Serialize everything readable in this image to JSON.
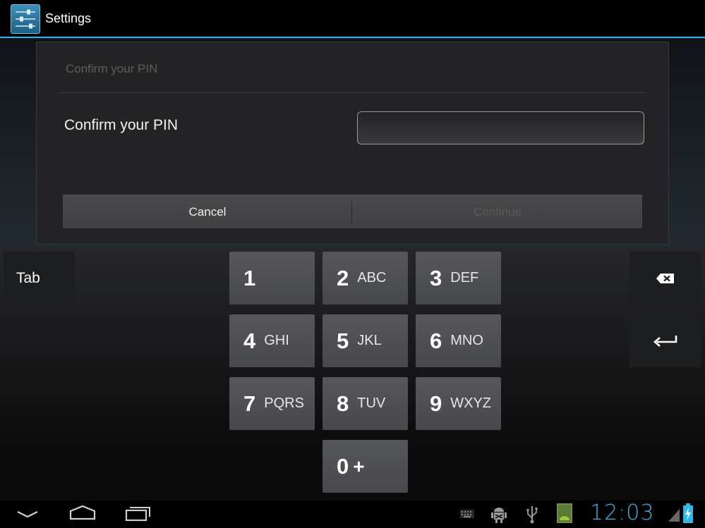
{
  "action_bar": {
    "title": "Settings",
    "icon": "settings-icon"
  },
  "dialog": {
    "title": "Confirm your PIN",
    "field_label": "Confirm your PIN",
    "pin_value": "",
    "buttons": {
      "cancel_label": "Cancel",
      "continue_label": "Continue"
    }
  },
  "keyboard": {
    "tab_label": "Tab",
    "keys": [
      {
        "digit": "1",
        "letters": ""
      },
      {
        "digit": "2",
        "letters": "ABC"
      },
      {
        "digit": "3",
        "letters": "DEF"
      },
      {
        "digit": "4",
        "letters": "GHI"
      },
      {
        "digit": "5",
        "letters": "JKL"
      },
      {
        "digit": "6",
        "letters": "MNO"
      },
      {
        "digit": "7",
        "letters": "PQRS"
      },
      {
        "digit": "8",
        "letters": "TUV"
      },
      {
        "digit": "9",
        "letters": "WXYZ"
      },
      {
        "digit": "0",
        "letters": "+"
      }
    ],
    "backspace_icon": "backspace-icon",
    "enter_icon": "enter-icon"
  },
  "navigation_bar": {
    "back_icon": "back-icon",
    "home_icon": "home-icon",
    "recents_icon": "recent-apps-icon"
  },
  "status_bar": {
    "time": "12:03",
    "icons": [
      "keyboard-icon",
      "android-debug-icon",
      "usb-icon",
      "screenshot-icon",
      "signal-icon",
      "battery-charging-icon"
    ],
    "accent_color": "#33b5e5"
  }
}
